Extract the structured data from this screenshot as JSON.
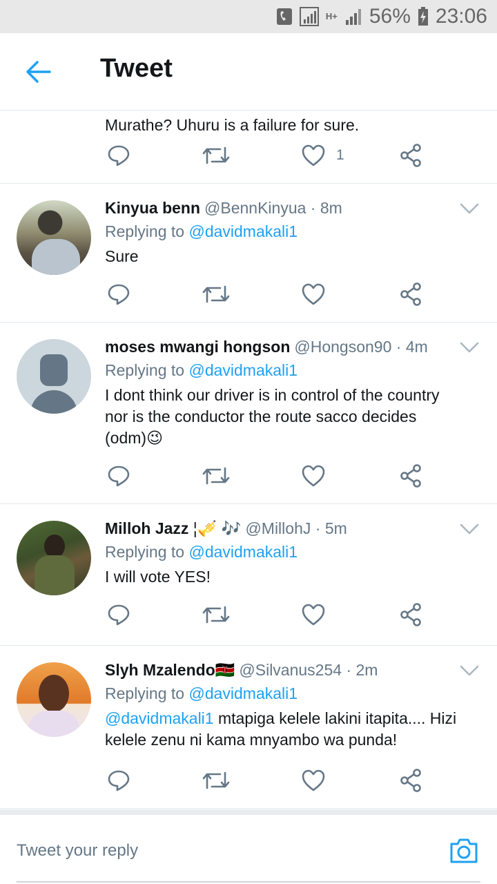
{
  "status_bar": {
    "battery": "56%",
    "time": "23:06",
    "network": "H+"
  },
  "header": {
    "title": "Tweet"
  },
  "partial_tweet": {
    "text": "Murathe? Uhuru is a failure for sure.",
    "like_count": "1"
  },
  "tweets": [
    {
      "name": "Kinyua benn",
      "handle": "@BennKinyua",
      "time": "8m",
      "replying_label": "Replying to",
      "replying_to": "@davidmakali1",
      "text": "Sure"
    },
    {
      "name": "moses mwangi hongson",
      "handle": "@Hongson90",
      "time": "4m",
      "replying_label": "Replying to",
      "replying_to": "@davidmakali1",
      "text_line1": "I dont think our driver is in control of the country",
      "text_line2": "nor is the conductor the route sacco decides",
      "text_line3": "(odm)",
      "emoji": "😉"
    },
    {
      "name": "Milloh Jazz",
      "name_emoji": "¦🎺 🎶",
      "handle": "@MillohJ",
      "time": "5m",
      "replying_label": "Replying to",
      "replying_to": "@davidmakali1",
      "text": "I will vote YES!"
    },
    {
      "name": "Slyh Mzalendo",
      "name_emoji": "🇰🇪",
      "handle": "@Silvanus254",
      "time": "2m",
      "replying_label": "Replying to",
      "replying_to": "@davidmakali1",
      "mention": "@davidmakali1",
      "text_line1": " mtapiga kelele lakini itapita.... Hizi",
      "text_line2": "kelele zenu ni kama mnyambo wa punda!"
    }
  ],
  "composer": {
    "placeholder": "Tweet your reply"
  },
  "icons": {
    "back": "back-arrow-icon",
    "reply": "reply-icon",
    "retweet": "retweet-icon",
    "like": "heart-icon",
    "share": "share-icon",
    "more": "chevron-down-icon",
    "camera": "camera-icon"
  },
  "colors": {
    "accent": "#1da1f2",
    "secondary_text": "#657786",
    "action_icon": "#657786",
    "divider": "#e1e8ed"
  }
}
